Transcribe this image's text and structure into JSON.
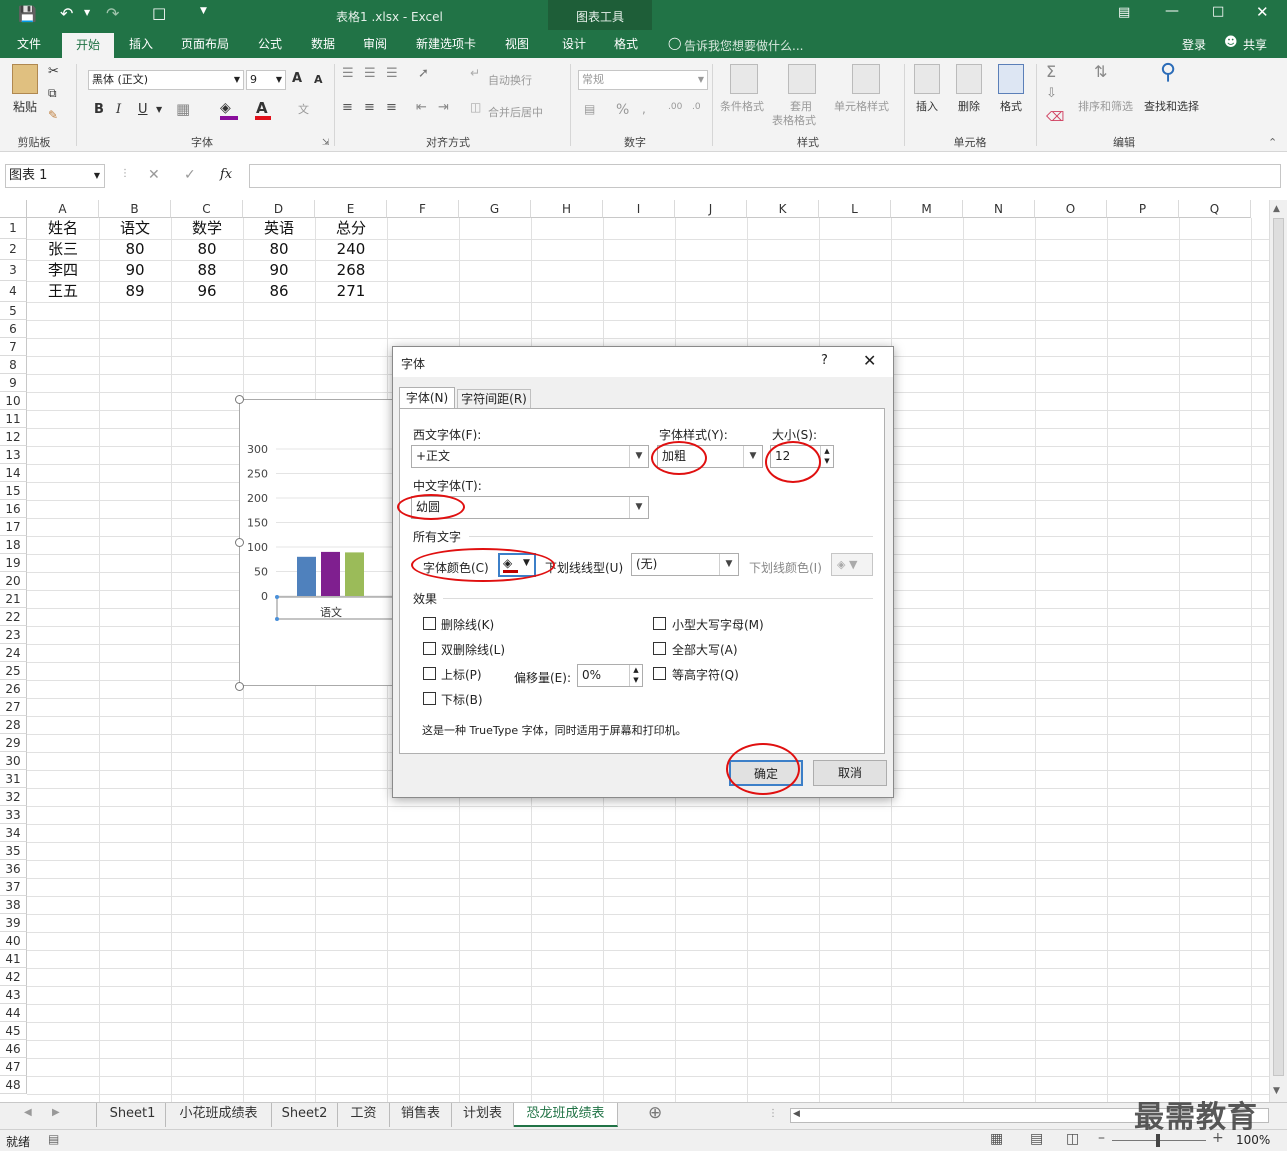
{
  "titlebar": {
    "filename": "表格1 .xlsx - Excel",
    "context_tools": "图表工具",
    "login": "登录",
    "share": "共享"
  },
  "tabs": [
    "文件",
    "开始",
    "插入",
    "页面布局",
    "公式",
    "数据",
    "审阅",
    "新建选项卡",
    "视图",
    "设计",
    "格式"
  ],
  "tell_me": "告诉我您想要做什么...",
  "ribbon": {
    "clipboard": {
      "paste": "粘贴",
      "label": "剪贴板"
    },
    "font": {
      "name": "黑体 (正文)",
      "size": "9",
      "bold": "B",
      "italic": "I",
      "underline": "U",
      "grow": "A",
      "shrink": "A",
      "label": "字体"
    },
    "alignment": {
      "wrap": "自动换行",
      "merge": "合并后居中",
      "label": "对齐方式"
    },
    "number": {
      "format": "常规",
      "percent": "%",
      "label": "数字"
    },
    "styles": {
      "conditional": "条件格式",
      "table1": "套用",
      "table2": "表格格式",
      "cell_styles": "单元格样式",
      "label": "样式"
    },
    "cells": {
      "insert": "插入",
      "delete": "删除",
      "format": "格式",
      "label": "单元格"
    },
    "editing": {
      "sort": "排序和筛选",
      "find": "查找和选择",
      "label": "编辑"
    }
  },
  "formula_bar": {
    "name_box": "图表 1",
    "fx": "fx",
    "content": ""
  },
  "columns": [
    "A",
    "B",
    "C",
    "D",
    "E",
    "F",
    "G",
    "H",
    "I",
    "J",
    "K",
    "L",
    "M",
    "N",
    "O",
    "P",
    "Q"
  ],
  "rows": [
    "1",
    "2",
    "3",
    "4",
    "5",
    "6",
    "7",
    "8",
    "9",
    "10",
    "11",
    "12",
    "13",
    "14",
    "15",
    "16",
    "17",
    "18",
    "19",
    "20",
    "21",
    "22",
    "23",
    "24",
    "25",
    "26",
    "27",
    "28",
    "29",
    "30",
    "31",
    "32",
    "33",
    "34",
    "35",
    "36",
    "37",
    "38",
    "39",
    "40",
    "41",
    "42",
    "43",
    "44",
    "45",
    "46",
    "47",
    "48"
  ],
  "table": [
    [
      "姓名",
      "语文",
      "数学",
      "英语",
      "总分"
    ],
    [
      "张三",
      "80",
      "80",
      "80",
      "240"
    ],
    [
      "李四",
      "90",
      "88",
      "90",
      "268"
    ],
    [
      "王五",
      "89",
      "96",
      "86",
      "271"
    ]
  ],
  "chart_data": {
    "type": "bar",
    "categories": [
      "语文"
    ],
    "series": [
      {
        "values": [
          80
        ],
        "color": "#4f81bd"
      },
      {
        "values": [
          90
        ],
        "color": "#7f1f8f"
      },
      {
        "values": [
          89
        ],
        "color": "#9bbb59"
      }
    ],
    "yticks": [
      "300",
      "250",
      "200",
      "150",
      "100",
      "50",
      "0"
    ],
    "ylim": [
      0,
      300
    ]
  },
  "dialog": {
    "title": "字体",
    "help": "?",
    "tab_font": "字体(N)",
    "tab_spacing": "字符间距(R)",
    "latin_font_label": "西文字体(F):",
    "latin_font_value": "+正文",
    "style_label": "字体样式(Y):",
    "style_value": "加粗",
    "size_label": "大小(S):",
    "size_value": "12",
    "asian_font_label": "中文字体(T):",
    "asian_font_value": "幼圆",
    "all_text": "所有文字",
    "font_color_label": "字体颜色(C)",
    "underline_style_label": "下划线线型(U)",
    "underline_style_value": "(无)",
    "underline_color_label": "下划线颜色(I)",
    "effects": "效果",
    "strikethrough": "删除线(K)",
    "double_strikethrough": "双删除线(L)",
    "superscript": "上标(P)",
    "subscript": "下标(B)",
    "offset_label": "偏移量(E):",
    "offset_value": "0%",
    "small_caps": "小型大写字母(M)",
    "all_caps": "全部大写(A)",
    "equalize": "等高字符(Q)",
    "description": "这是一种 TrueType 字体，同时适用于屏幕和打印机。",
    "ok": "确定",
    "cancel": "取消"
  },
  "sheet_tabs": [
    "Sheet1",
    "小花班成绩表",
    "Sheet2",
    "工资",
    "销售表",
    "计划表",
    "恐龙班成绩表"
  ],
  "status": {
    "ready": "就绪",
    "zoom": "100%"
  },
  "watermark": "最需教育"
}
